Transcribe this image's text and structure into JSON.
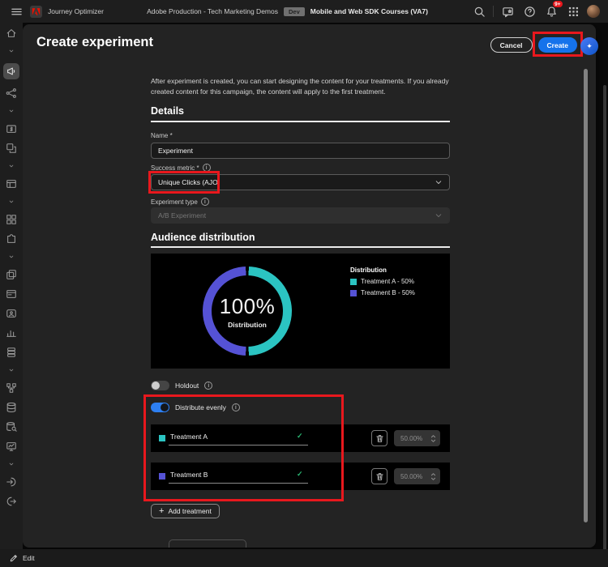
{
  "topbar": {
    "product_name": "Journey Optimizer",
    "org_name": "Adobe Production - Tech Marketing Demos",
    "env_badge": "Dev",
    "sandbox_name": "Mobile and Web SDK Courses (VA7)",
    "notification_badge": "9+",
    "icons": [
      "menu",
      "adobe-logo",
      "search",
      "feedback",
      "help",
      "notifications",
      "app-switcher",
      "avatar"
    ]
  },
  "sidebar": {
    "icons": [
      "home",
      "chevron-down",
      "campaigns-active",
      "journeys",
      "chevron-down",
      "offers",
      "decisions",
      "chevron-down",
      "schedules",
      "chevron-down",
      "assets",
      "fragments",
      "chevron-down",
      "templates",
      "landing-pages",
      "profiles",
      "audiences",
      "subscriptions",
      "chevron-down",
      "schemas",
      "datasets",
      "queries",
      "monitoring",
      "chevron-down",
      "sources",
      "destinations"
    ]
  },
  "modal": {
    "title": "Create experiment",
    "buttons": {
      "cancel": "Cancel",
      "create": "Create"
    },
    "description": "After experiment is created, you can start designing the content for your treatments. If you already created content for this campaign, the content will apply to the first treatment.",
    "details": {
      "heading": "Details",
      "name_label": "Name *",
      "name_value": "Experiment",
      "success_metric_label": "Success metric *",
      "success_metric_value": "Unique Clicks (AJO)",
      "experiment_type_label": "Experiment type",
      "experiment_type_value": "A/B Experiment"
    },
    "audience": {
      "heading": "Audience distribution",
      "holdout_label": "Holdout",
      "distribute_evenly_label": "Distribute evenly",
      "treatments": [
        {
          "name": "Treatment A",
          "percent_value": "50.00%",
          "swatch_color": "#2BC4C2"
        },
        {
          "name": "Treatment B",
          "percent_value": "50.00%",
          "swatch_color": "#5552D5"
        }
      ],
      "add_treatment_label": "Add treatment"
    }
  },
  "chart_data": {
    "type": "pie",
    "donut": true,
    "center_value": "100%",
    "center_label": "Distribution",
    "legend_title": "Distribution",
    "legend_position": "right",
    "slices": [
      {
        "label": "Treatment A - 50%",
        "value": 50,
        "color": "#2BC4C2"
      },
      {
        "label": "Treatment B - 50%",
        "value": 50,
        "color": "#5552D5"
      }
    ]
  },
  "annotations": {
    "color": "#E8181D",
    "boxes": [
      "create-button",
      "success-metric-value",
      "distribute-evenly-and-treatments"
    ]
  },
  "footer": {
    "edit_label": "Edit"
  },
  "colors": {
    "accent_blue": "#1573EB",
    "toggle_blue": "#2D7FF2",
    "teal": "#2BC4C2",
    "purple": "#5552D5",
    "success_green": "#2BB673",
    "annotation_red": "#E8181D"
  }
}
